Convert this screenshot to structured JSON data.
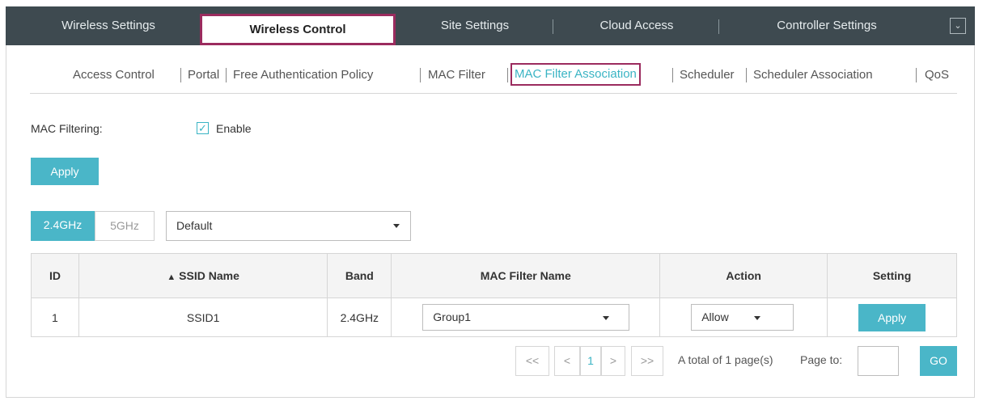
{
  "topnav": {
    "tabs": [
      {
        "label": "Wireless Settings"
      },
      {
        "label": "Wireless Control"
      },
      {
        "label": "Site Settings"
      },
      {
        "label": "Cloud Access"
      },
      {
        "label": "Controller Settings"
      }
    ],
    "active_index": 1,
    "menu_icon": "chevron-down-icon"
  },
  "subnav": {
    "items": [
      {
        "label": "Access Control"
      },
      {
        "label": "Portal"
      },
      {
        "label": "Free Authentication Policy"
      },
      {
        "label": "MAC Filter"
      },
      {
        "label": "MAC Filter Association"
      },
      {
        "label": "Scheduler"
      },
      {
        "label": "Scheduler Association"
      },
      {
        "label": "QoS"
      }
    ],
    "active_index": 4
  },
  "form": {
    "mac_filtering_label": "MAC Filtering:",
    "enable_label": "Enable",
    "enable_checked": true,
    "apply_label": "Apply"
  },
  "band": {
    "tabs": [
      "2.4GHz",
      "5GHz"
    ],
    "active": "2.4GHz",
    "wlan_group": "Default"
  },
  "table": {
    "headers": {
      "id": "ID",
      "ssid": "SSID Name",
      "band": "Band",
      "mac_filter": "MAC Filter Name",
      "action": "Action",
      "setting": "Setting"
    },
    "rows": [
      {
        "id": "1",
        "ssid": "SSID1",
        "band": "2.4GHz",
        "mac_filter": "Group1",
        "action": "Allow",
        "setting": "Apply"
      }
    ]
  },
  "pagination": {
    "first": "<<",
    "prev": "<",
    "current": "1",
    "next": ">",
    "last": ">>",
    "total_text": "A total of 1 page(s)",
    "page_to_label": "Page to:",
    "go_label": "GO"
  },
  "colors": {
    "nav_bg": "#3e4a50",
    "accent": "#4ab6c8",
    "highlight_border": "#9b2b5e"
  }
}
